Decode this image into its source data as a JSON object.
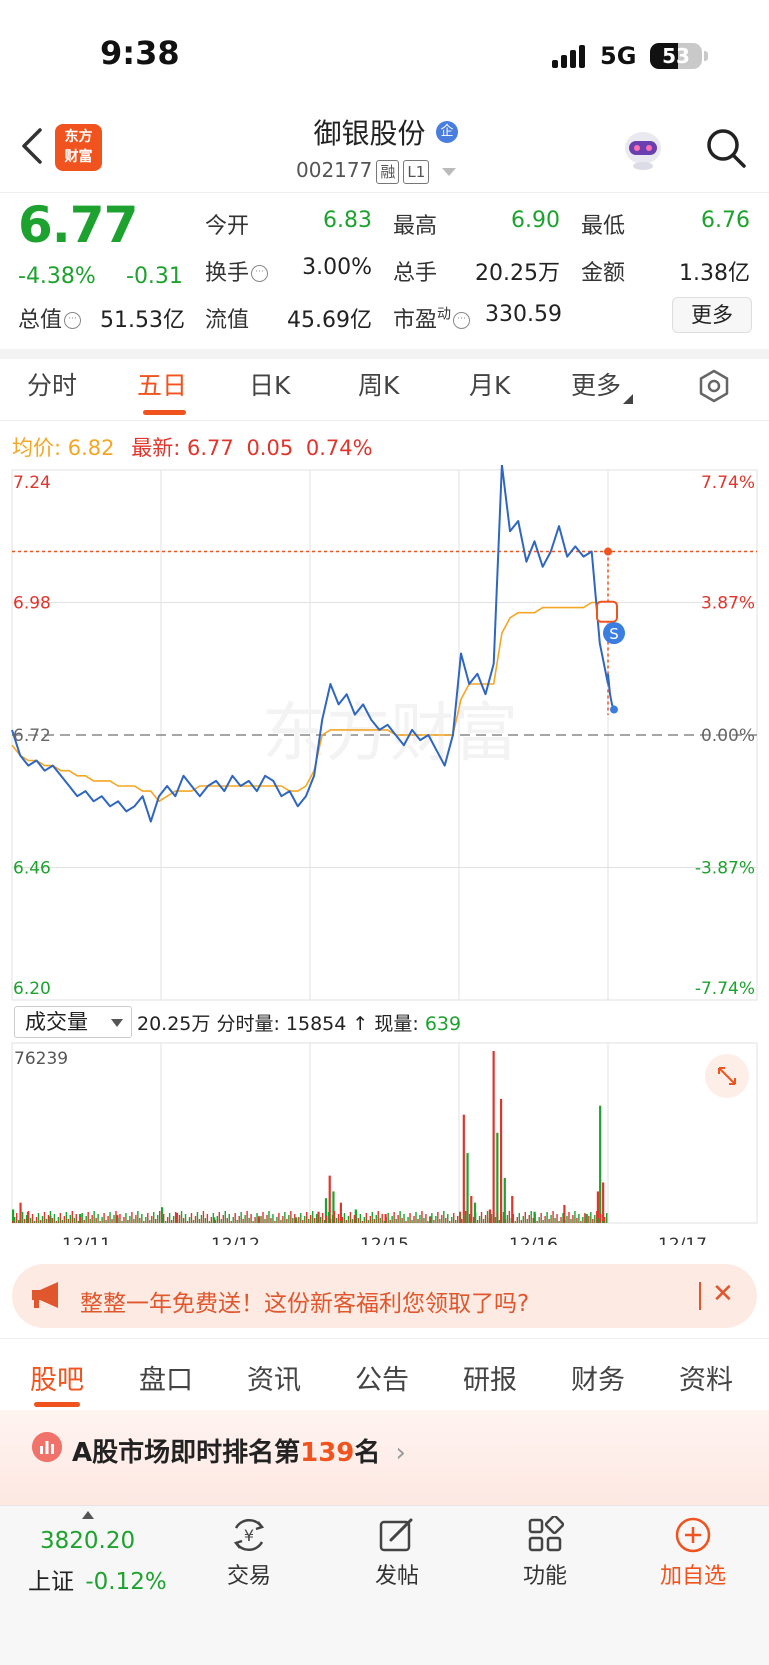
{
  "status_bar": {
    "time": "9:38",
    "network": "5G",
    "battery": "53",
    "battery_level": 0.53
  },
  "header": {
    "logo_line1": "东方",
    "logo_line2": "财富",
    "stock_name": "御银股份",
    "name_badge": "企",
    "code": "002177",
    "tags": [
      "融",
      "L1"
    ]
  },
  "quote": {
    "price": "6.77",
    "change_pct": "-4.38%",
    "change": "-0.31",
    "fields": [
      {
        "label": "今开",
        "value": "6.83",
        "color": "green"
      },
      {
        "label": "最高",
        "value": "6.90",
        "color": "green"
      },
      {
        "label": "最低",
        "value": "6.76",
        "color": "green"
      },
      {
        "label": "换手",
        "value": "3.00%",
        "color": "dark"
      },
      {
        "label": "总手",
        "value": "20.25万",
        "color": "dark"
      },
      {
        "label": "金额",
        "value": "1.38亿",
        "color": "dark"
      },
      {
        "label": "总值",
        "value": "51.53亿",
        "color": "dark"
      },
      {
        "label": "流值",
        "value": "45.69亿",
        "color": "dark"
      },
      {
        "label": "市盈",
        "label_sup": "动",
        "value": "330.59",
        "color": "dark"
      }
    ],
    "more_button": "更多"
  },
  "chart_tabs": [
    "分时",
    "五日",
    "日K",
    "周K",
    "月K",
    "更多"
  ],
  "active_chart_tab": "五日",
  "avg_row": {
    "avg_label": "均价:",
    "avg_value": "6.82",
    "latest_label": "最新:",
    "latest_value": "6.77",
    "latest_change": "0.05",
    "latest_pct": "0.74%"
  },
  "chart_data": {
    "type": "line",
    "title": "",
    "x_days": [
      "12/11",
      "12/12",
      "12/15",
      "12/16",
      "12/17"
    ],
    "y_ticks_left": [
      "7.24",
      "6.98",
      "6.72",
      "6.46",
      "6.20"
    ],
    "y_ticks_right": [
      "7.74%",
      "3.87%",
      "0.00%",
      "-3.87%",
      "-7.74%"
    ],
    "ylim": [
      6.2,
      7.24
    ],
    "baseline": 6.72,
    "watermark": "东方财富",
    "series": [
      {
        "name": "price",
        "color": "#2f66c2",
        "values": [
          6.73,
          6.68,
          6.66,
          6.67,
          6.65,
          6.66,
          6.64,
          6.62,
          6.6,
          6.61,
          6.59,
          6.6,
          6.58,
          6.59,
          6.57,
          6.58,
          6.6,
          6.55,
          6.6,
          6.62,
          6.6,
          6.64,
          6.62,
          6.6,
          6.62,
          6.63,
          6.61,
          6.64,
          6.62,
          6.63,
          6.61,
          6.64,
          6.63,
          6.6,
          6.61,
          6.58,
          6.6,
          6.64,
          6.75,
          6.82,
          6.78,
          6.8,
          6.76,
          6.78,
          6.75,
          6.73,
          6.74,
          6.72,
          6.7,
          6.73,
          6.71,
          6.72,
          6.69,
          6.66,
          6.72,
          6.88,
          6.82,
          6.84,
          6.8,
          6.86,
          7.25,
          7.12,
          7.14,
          7.06,
          7.1,
          7.05,
          7.08,
          7.13,
          7.07,
          7.09,
          7.07,
          7.08,
          6.9,
          6.82
        ]
      },
      {
        "name": "avg",
        "color": "#f5a623",
        "values": [
          6.7,
          6.68,
          6.67,
          6.67,
          6.66,
          6.66,
          6.65,
          6.65,
          6.64,
          6.64,
          6.63,
          6.63,
          6.63,
          6.62,
          6.62,
          6.62,
          6.61,
          6.61,
          6.59,
          6.6,
          6.61,
          6.61,
          6.61,
          6.62,
          6.62,
          6.62,
          6.62,
          6.62,
          6.62,
          6.62,
          6.62,
          6.62,
          6.62,
          6.62,
          6.61,
          6.61,
          6.62,
          6.65,
          6.72,
          6.73,
          6.73,
          6.73,
          6.73,
          6.73,
          6.73,
          6.73,
          6.73,
          6.72,
          6.72,
          6.72,
          6.72,
          6.72,
          6.72,
          6.72,
          6.72,
          6.79,
          6.82,
          6.82,
          6.82,
          6.82,
          6.92,
          6.95,
          6.96,
          6.96,
          6.96,
          6.97,
          6.97,
          6.97,
          6.97,
          6.97,
          6.97,
          6.98,
          6.98,
          6.98
        ]
      }
    ],
    "latest_price": 6.77
  },
  "volume": {
    "selector": "成交量",
    "total": "20.25万",
    "tick_label": "分时量:",
    "tick_value": "15854",
    "arrow": "↑",
    "now_label": "现量:",
    "now_value": "639",
    "max_label": "76239",
    "max": 76239,
    "bars": [
      {
        "pos": 0.0,
        "v": 6000,
        "c": "#1ea22f"
      },
      {
        "pos": 0.01,
        "v": 9000,
        "c": "#e0352c"
      },
      {
        "pos": 0.02,
        "v": 5000,
        "c": "#1ea22f"
      },
      {
        "pos": 0.05,
        "v": 3000,
        "c": "#e0352c"
      },
      {
        "pos": 0.09,
        "v": 4000,
        "c": "#1ea22f"
      },
      {
        "pos": 0.14,
        "v": 3500,
        "c": "#e0352c"
      },
      {
        "pos": 0.2,
        "v": 7000,
        "c": "#1ea22f"
      },
      {
        "pos": 0.22,
        "v": 4500,
        "c": "#e0352c"
      },
      {
        "pos": 0.27,
        "v": 2500,
        "c": "#1ea22f"
      },
      {
        "pos": 0.33,
        "v": 3000,
        "c": "#e0352c"
      },
      {
        "pos": 0.38,
        "v": 2500,
        "c": "#1ea22f"
      },
      {
        "pos": 0.41,
        "v": 5000,
        "c": "#e0352c"
      },
      {
        "pos": 0.42,
        "v": 11000,
        "c": "#1ea22f"
      },
      {
        "pos": 0.425,
        "v": 21000,
        "c": "#e0352c"
      },
      {
        "pos": 0.43,
        "v": 14000,
        "c": "#1ea22f"
      },
      {
        "pos": 0.44,
        "v": 9000,
        "c": "#e0352c"
      },
      {
        "pos": 0.46,
        "v": 6000,
        "c": "#1ea22f"
      },
      {
        "pos": 0.5,
        "v": 4000,
        "c": "#e0352c"
      },
      {
        "pos": 0.56,
        "v": 3000,
        "c": "#1ea22f"
      },
      {
        "pos": 0.6,
        "v": 5000,
        "c": "#e0352c"
      },
      {
        "pos": 0.605,
        "v": 48000,
        "c": "#e0352c"
      },
      {
        "pos": 0.61,
        "v": 31000,
        "c": "#1ea22f"
      },
      {
        "pos": 0.615,
        "v": 12000,
        "c": "#e0352c"
      },
      {
        "pos": 0.62,
        "v": 9000,
        "c": "#1ea22f"
      },
      {
        "pos": 0.64,
        "v": 6000,
        "c": "#e0352c"
      },
      {
        "pos": 0.645,
        "v": 76239,
        "c": "#e0352c"
      },
      {
        "pos": 0.65,
        "v": 40000,
        "c": "#1ea22f"
      },
      {
        "pos": 0.655,
        "v": 55000,
        "c": "#e0352c"
      },
      {
        "pos": 0.66,
        "v": 20000,
        "c": "#1ea22f"
      },
      {
        "pos": 0.67,
        "v": 12000,
        "c": "#e0352c"
      },
      {
        "pos": 0.7,
        "v": 5000,
        "c": "#1ea22f"
      },
      {
        "pos": 0.74,
        "v": 8000,
        "c": "#e0352c"
      },
      {
        "pos": 0.77,
        "v": 4000,
        "c": "#1ea22f"
      },
      {
        "pos": 0.785,
        "v": 14000,
        "c": "#e0352c"
      },
      {
        "pos": 0.788,
        "v": 52000,
        "c": "#1ea22f"
      },
      {
        "pos": 0.792,
        "v": 18000,
        "c": "#e0352c"
      }
    ]
  },
  "banner": {
    "text": "整整一年免费送！这份新客福利您领取了吗?",
    "close": "✕"
  },
  "bottom_tabs": [
    "股吧",
    "盘口",
    "资讯",
    "公告",
    "研报",
    "财务",
    "资料"
  ],
  "active_bottom_tab": "股吧",
  "rank": {
    "prefix": "A股市场即时排名第",
    "number": "139",
    "suffix": "名",
    "chevron": "›"
  },
  "index": {
    "value": "3820.20",
    "name": "上证",
    "change": "-0.12%"
  },
  "nav": [
    {
      "label": "交易",
      "icon": "yen-exchange-icon"
    },
    {
      "label": "发帖",
      "icon": "edit-icon"
    },
    {
      "label": "功能",
      "icon": "grid-icon"
    },
    {
      "label": "加自选",
      "icon": "add-circle-icon"
    }
  ],
  "colors": {
    "accent": "#f1531e",
    "down": "#1ea22f",
    "up": "#e0352c",
    "price_line": "#2f66c2",
    "avg_line": "#f5a623"
  }
}
